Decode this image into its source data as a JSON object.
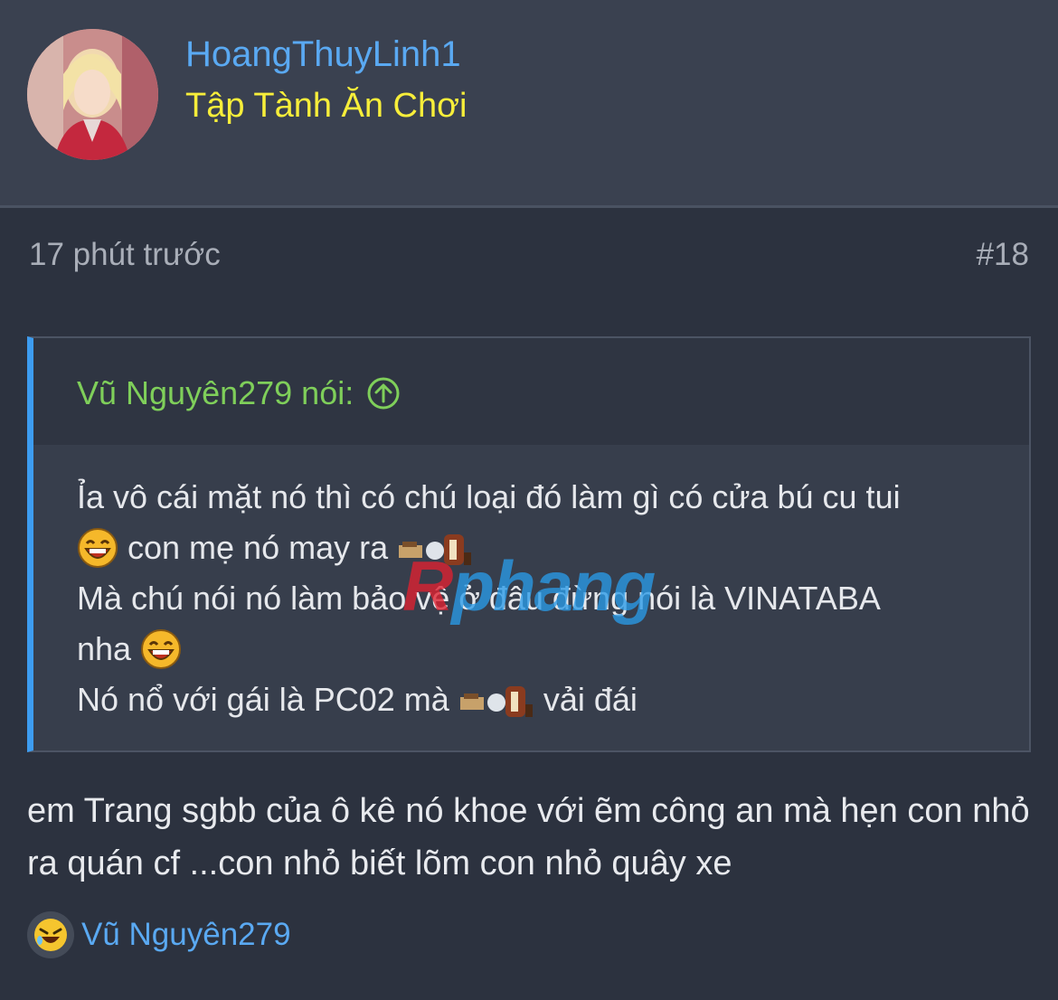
{
  "author": {
    "username": "HoangThuyLinh1",
    "title": "Tập Tành Ăn Chơi"
  },
  "post": {
    "time": "17 phút trước",
    "number": "#18"
  },
  "quote": {
    "author": "Vũ Nguyên279 nói:",
    "lines": [
      "Ỉa vô cái mặt nó thì có chú loại đó làm gì có cửa bú cu tui",
      "con mẹ nó may ra",
      "Mà chú nói nó làm bảo vệ ở đâu đừng nói là VINATABA",
      "nha",
      "Nó nổ với gái là PC02 mà",
      "vải đái"
    ]
  },
  "watermark": {
    "part1": "R",
    "part2": "phang"
  },
  "reply": {
    "text": "em Trang sgbb của ô kê nó khoe với ẽm công an mà hẹn con nhỏ ra quán cf ...con nhỏ biết lõm con nhỏ quây xe"
  },
  "reactions": {
    "names": "Vũ Nguyên279",
    "icon": "laughing-emoji-icon"
  },
  "colors": {
    "username": "#5aa9f2",
    "usertitle": "#f7ee3a",
    "quote_author": "#7fcf5a",
    "quote_border": "#3d9cf0"
  }
}
